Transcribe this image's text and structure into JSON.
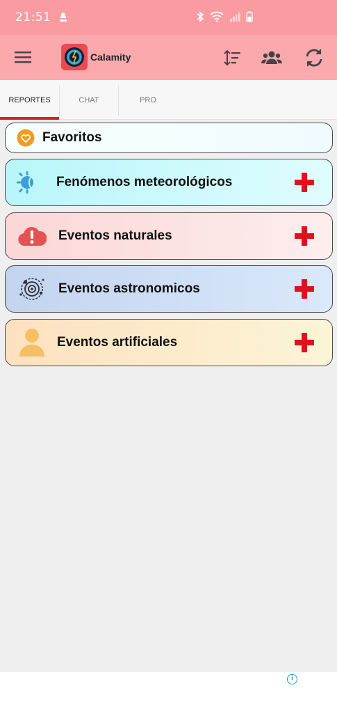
{
  "status_bar": {
    "time": "21:51"
  },
  "app": {
    "title": "Calamity"
  },
  "tabs": [
    {
      "label": "REPORTES",
      "active": true
    },
    {
      "label": "CHAT",
      "active": false
    },
    {
      "label": "PRO",
      "active": false
    }
  ],
  "categories": {
    "favorites": {
      "label": "Favoritos"
    },
    "weather": {
      "label": "Fenómenos meteorológicos"
    },
    "natural": {
      "label": "Eventos naturales"
    },
    "astronomical": {
      "label": "Eventos astronomicos"
    },
    "artificial": {
      "label": "Eventos artificiales"
    }
  },
  "colors": {
    "status_bar": "#f99ba0",
    "app_bar": "#fca9ad",
    "tab_indicator": "#d9202a",
    "plus": "#e0111c"
  },
  "icons": {
    "toolbar": [
      "menu-icon",
      "app-logo",
      "sort-icon",
      "group-icon",
      "refresh-icon"
    ],
    "categories": [
      "heart-icon",
      "weather-icon",
      "alert-cloud-icon",
      "orbit-icon",
      "person-icon"
    ]
  }
}
